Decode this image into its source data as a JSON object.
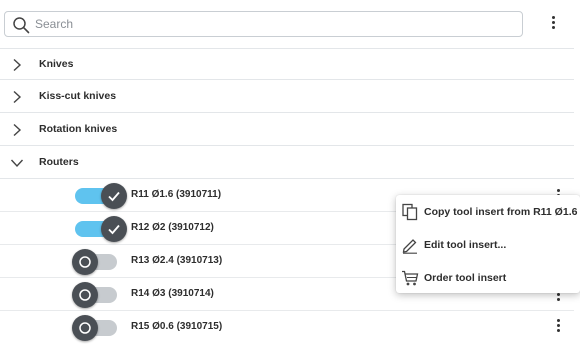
{
  "search": {
    "placeholder": "Search",
    "value": ""
  },
  "categories": [
    {
      "label": "Knives",
      "expanded": false
    },
    {
      "label": "Kiss-cut knives",
      "expanded": false
    },
    {
      "label": "Rotation knives",
      "expanded": false
    },
    {
      "label": "Routers",
      "expanded": true
    }
  ],
  "tools": [
    {
      "label": "R11 Ø1.6 (3910711)",
      "enabled": true
    },
    {
      "label": "R12 Ø2 (3910712)",
      "enabled": true
    },
    {
      "label": "R13 Ø2.4 (3910713)",
      "enabled": false
    },
    {
      "label": "R14 Ø3 (3910714)",
      "enabled": false
    },
    {
      "label": "R15 Ø0.6 (3910715)",
      "enabled": false
    }
  ],
  "context_menu": {
    "items": [
      {
        "label": "Copy tool insert from R11 Ø1.6",
        "icon": "copy-icon"
      },
      {
        "label": "Edit tool insert...",
        "icon": "pencil-icon"
      },
      {
        "label": "Order tool insert",
        "icon": "cart-icon"
      }
    ]
  },
  "colors": {
    "toggle_on": "#5fc3ef",
    "toggle_off": "#c7cbcf",
    "knob": "#4a4f55"
  }
}
